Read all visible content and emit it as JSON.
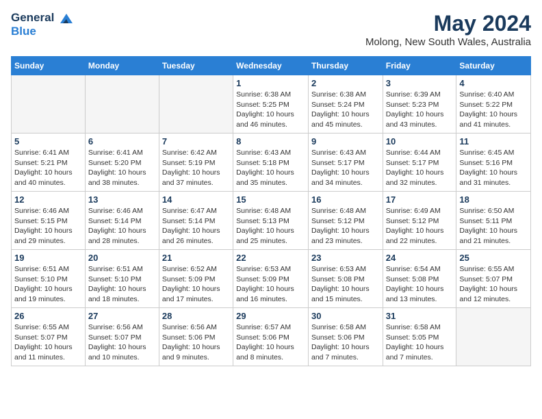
{
  "logo": {
    "line1": "General",
    "line2": "Blue"
  },
  "title": "May 2024",
  "location": "Molong, New South Wales, Australia",
  "weekdays": [
    "Sunday",
    "Monday",
    "Tuesday",
    "Wednesday",
    "Thursday",
    "Friday",
    "Saturday"
  ],
  "weeks": [
    [
      {
        "day": "",
        "info": ""
      },
      {
        "day": "",
        "info": ""
      },
      {
        "day": "",
        "info": ""
      },
      {
        "day": "1",
        "info": "Sunrise: 6:38 AM\nSunset: 5:25 PM\nDaylight: 10 hours\nand 46 minutes."
      },
      {
        "day": "2",
        "info": "Sunrise: 6:38 AM\nSunset: 5:24 PM\nDaylight: 10 hours\nand 45 minutes."
      },
      {
        "day": "3",
        "info": "Sunrise: 6:39 AM\nSunset: 5:23 PM\nDaylight: 10 hours\nand 43 minutes."
      },
      {
        "day": "4",
        "info": "Sunrise: 6:40 AM\nSunset: 5:22 PM\nDaylight: 10 hours\nand 41 minutes."
      }
    ],
    [
      {
        "day": "5",
        "info": "Sunrise: 6:41 AM\nSunset: 5:21 PM\nDaylight: 10 hours\nand 40 minutes."
      },
      {
        "day": "6",
        "info": "Sunrise: 6:41 AM\nSunset: 5:20 PM\nDaylight: 10 hours\nand 38 minutes."
      },
      {
        "day": "7",
        "info": "Sunrise: 6:42 AM\nSunset: 5:19 PM\nDaylight: 10 hours\nand 37 minutes."
      },
      {
        "day": "8",
        "info": "Sunrise: 6:43 AM\nSunset: 5:18 PM\nDaylight: 10 hours\nand 35 minutes."
      },
      {
        "day": "9",
        "info": "Sunrise: 6:43 AM\nSunset: 5:17 PM\nDaylight: 10 hours\nand 34 minutes."
      },
      {
        "day": "10",
        "info": "Sunrise: 6:44 AM\nSunset: 5:17 PM\nDaylight: 10 hours\nand 32 minutes."
      },
      {
        "day": "11",
        "info": "Sunrise: 6:45 AM\nSunset: 5:16 PM\nDaylight: 10 hours\nand 31 minutes."
      }
    ],
    [
      {
        "day": "12",
        "info": "Sunrise: 6:46 AM\nSunset: 5:15 PM\nDaylight: 10 hours\nand 29 minutes."
      },
      {
        "day": "13",
        "info": "Sunrise: 6:46 AM\nSunset: 5:14 PM\nDaylight: 10 hours\nand 28 minutes."
      },
      {
        "day": "14",
        "info": "Sunrise: 6:47 AM\nSunset: 5:14 PM\nDaylight: 10 hours\nand 26 minutes."
      },
      {
        "day": "15",
        "info": "Sunrise: 6:48 AM\nSunset: 5:13 PM\nDaylight: 10 hours\nand 25 minutes."
      },
      {
        "day": "16",
        "info": "Sunrise: 6:48 AM\nSunset: 5:12 PM\nDaylight: 10 hours\nand 23 minutes."
      },
      {
        "day": "17",
        "info": "Sunrise: 6:49 AM\nSunset: 5:12 PM\nDaylight: 10 hours\nand 22 minutes."
      },
      {
        "day": "18",
        "info": "Sunrise: 6:50 AM\nSunset: 5:11 PM\nDaylight: 10 hours\nand 21 minutes."
      }
    ],
    [
      {
        "day": "19",
        "info": "Sunrise: 6:51 AM\nSunset: 5:10 PM\nDaylight: 10 hours\nand 19 minutes."
      },
      {
        "day": "20",
        "info": "Sunrise: 6:51 AM\nSunset: 5:10 PM\nDaylight: 10 hours\nand 18 minutes."
      },
      {
        "day": "21",
        "info": "Sunrise: 6:52 AM\nSunset: 5:09 PM\nDaylight: 10 hours\nand 17 minutes."
      },
      {
        "day": "22",
        "info": "Sunrise: 6:53 AM\nSunset: 5:09 PM\nDaylight: 10 hours\nand 16 minutes."
      },
      {
        "day": "23",
        "info": "Sunrise: 6:53 AM\nSunset: 5:08 PM\nDaylight: 10 hours\nand 15 minutes."
      },
      {
        "day": "24",
        "info": "Sunrise: 6:54 AM\nSunset: 5:08 PM\nDaylight: 10 hours\nand 13 minutes."
      },
      {
        "day": "25",
        "info": "Sunrise: 6:55 AM\nSunset: 5:07 PM\nDaylight: 10 hours\nand 12 minutes."
      }
    ],
    [
      {
        "day": "26",
        "info": "Sunrise: 6:55 AM\nSunset: 5:07 PM\nDaylight: 10 hours\nand 11 minutes."
      },
      {
        "day": "27",
        "info": "Sunrise: 6:56 AM\nSunset: 5:07 PM\nDaylight: 10 hours\nand 10 minutes."
      },
      {
        "day": "28",
        "info": "Sunrise: 6:56 AM\nSunset: 5:06 PM\nDaylight: 10 hours\nand 9 minutes."
      },
      {
        "day": "29",
        "info": "Sunrise: 6:57 AM\nSunset: 5:06 PM\nDaylight: 10 hours\nand 8 minutes."
      },
      {
        "day": "30",
        "info": "Sunrise: 6:58 AM\nSunset: 5:06 PM\nDaylight: 10 hours\nand 7 minutes."
      },
      {
        "day": "31",
        "info": "Sunrise: 6:58 AM\nSunset: 5:05 PM\nDaylight: 10 hours\nand 7 minutes."
      },
      {
        "day": "",
        "info": ""
      }
    ]
  ]
}
